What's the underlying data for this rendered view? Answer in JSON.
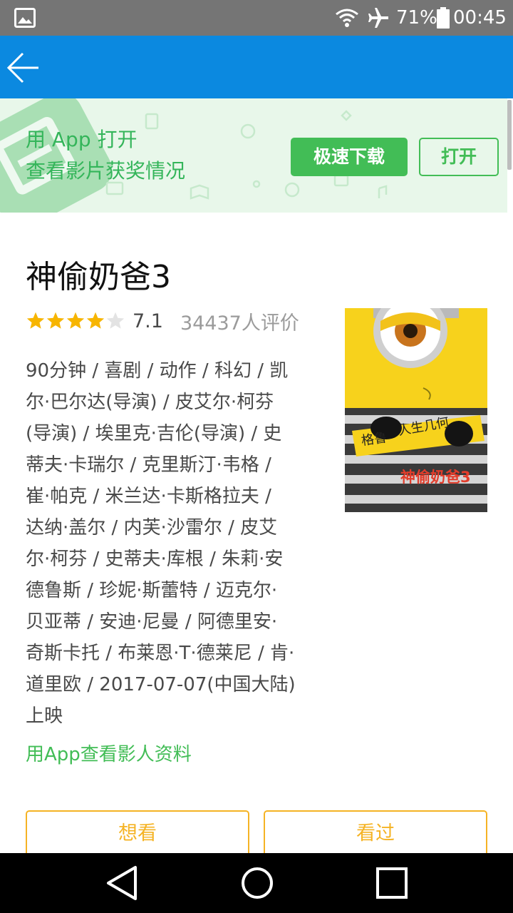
{
  "status_bar": {
    "battery_percent": "71%",
    "time": "00:45",
    "icons": [
      "gallery-icon",
      "wifi-icon",
      "airplane-icon",
      "battery-icon"
    ]
  },
  "app_bar": {
    "back_icon": "arrow-left-icon",
    "color": "#0b89e0"
  },
  "banner": {
    "line1": "用 App 打开",
    "line2": "查看影片获奖情况",
    "download_label": "极速下载",
    "open_label": "打开",
    "accent": "#42bd56"
  },
  "movie": {
    "title": "神偷奶爸3",
    "stars_filled": 4,
    "stars_total": 5,
    "rating": "7.1",
    "rating_count": "34437人评价",
    "info_lines": [
      "90分钟 / 喜剧 / 动作 / 科幻 / 凯",
      "尔·巴尔达(导演) / 皮艾尔·柯芬",
      "(导演) / 埃里克·吉伦(导演) / 史",
      "蒂夫·卡瑞尔 / 克里斯汀·韦格 /",
      "崔·帕克 / 米兰达·卡斯格拉夫 /",
      "达纳·盖尔 / 内芙·沙雷尔 / 皮艾",
      "尔·柯芬 / 史蒂夫·库根 / 朱莉·安",
      "德鲁斯 / 珍妮·斯蕾特 / 迈克尔·",
      "贝亚蒂 / 安迪·尼曼 / 阿德里安·",
      "奇斯卡托 / 布莱恩·T·德莱尼 / 肯·",
      "道里欧 / 2017-07-07(中国大陆)",
      "上映"
    ],
    "app_link": "用App查看影人资料",
    "poster": {
      "text_a": "格鲁",
      "text_b": "人生几何",
      "title_text": "神偷奶爸3"
    }
  },
  "actions": {
    "want_label": "想看",
    "seen_label": "看过",
    "accent": "#f5b324"
  },
  "nav_bar": {
    "icons": [
      "nav-back-icon",
      "nav-home-icon",
      "nav-recent-icon"
    ]
  }
}
